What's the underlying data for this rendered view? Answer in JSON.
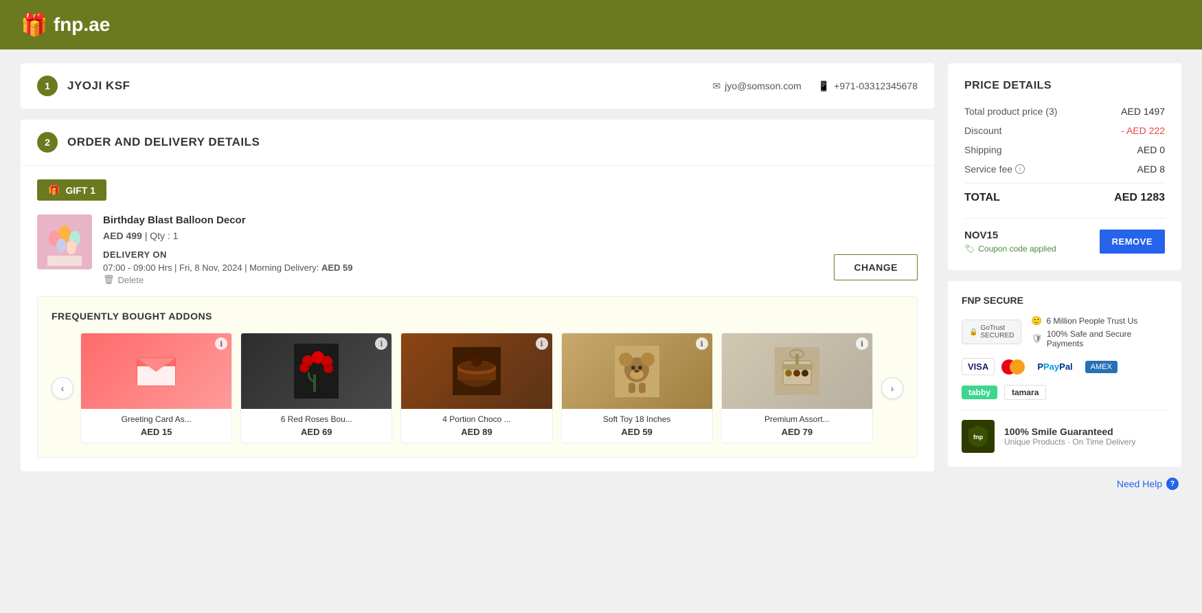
{
  "header": {
    "logo_text": "fnp.ae",
    "logo_icon": "🎁"
  },
  "user_section": {
    "step": "1",
    "name": "JYOJI KSF",
    "email": "jyo@somson.com",
    "phone": "+971-03312345678",
    "email_icon": "✉",
    "phone_icon": "📱"
  },
  "order_section": {
    "step": "2",
    "title": "ORDER AND DELIVERY DETAILS",
    "gift_label": "GIFT 1",
    "product": {
      "name": "Birthday Blast Balloon Decor",
      "price": "AED 499",
      "qty_label": "Qty : 1",
      "delivery_label": "DELIVERY ON",
      "delivery_time": "07:00 - 09:00 Hrs | Fri, 8 Nov, 2024 | Morning Delivery:",
      "morning_price": "AED 59",
      "delete_label": "Delete",
      "change_btn": "CHANGE"
    }
  },
  "addons": {
    "title": "FREQUENTLY BOUGHT ADDONS",
    "items": [
      {
        "name": "Greeting Card As...",
        "price": "AED 15",
        "type": "greeting"
      },
      {
        "name": "6 Red Roses Bou...",
        "price": "AED 69",
        "type": "roses"
      },
      {
        "name": "4 Portion Choco ...",
        "price": "AED 89",
        "type": "cake"
      },
      {
        "name": "Soft Toy 18 Inches",
        "price": "AED 59",
        "type": "teddy"
      },
      {
        "name": "Premium Assort...",
        "price": "AED 79",
        "type": "premium"
      }
    ]
  },
  "price_details": {
    "title": "PRICE DETAILS",
    "rows": [
      {
        "label": "Total product price (3)",
        "value": "AED 1497"
      },
      {
        "label": "Discount",
        "value": "- AED 222",
        "is_discount": true
      },
      {
        "label": "Shipping",
        "value": "AED 0"
      },
      {
        "label": "Service fee",
        "value": "AED 8",
        "has_info": true
      }
    ],
    "total_label": "TOTAL",
    "total_value": "AED 1283",
    "coupon_code": "NOV15",
    "coupon_applied_text": "Coupon code applied",
    "remove_btn": "REMOVE"
  },
  "fnp_secure": {
    "title": "FNP SECURE",
    "trust_badge_text": "GoTrust SECURED",
    "trust_items": [
      "6 Million People Trust Us",
      "100% Safe and Secure Payments"
    ],
    "payment_methods": [
      "VISA",
      "Mastercard",
      "PayPal",
      "AMEX",
      "tabby",
      "tamara"
    ],
    "smile_title": "100% Smile Guaranteed",
    "smile_sub": "Unique Products · On Time Delivery",
    "need_help": "Need Help"
  }
}
